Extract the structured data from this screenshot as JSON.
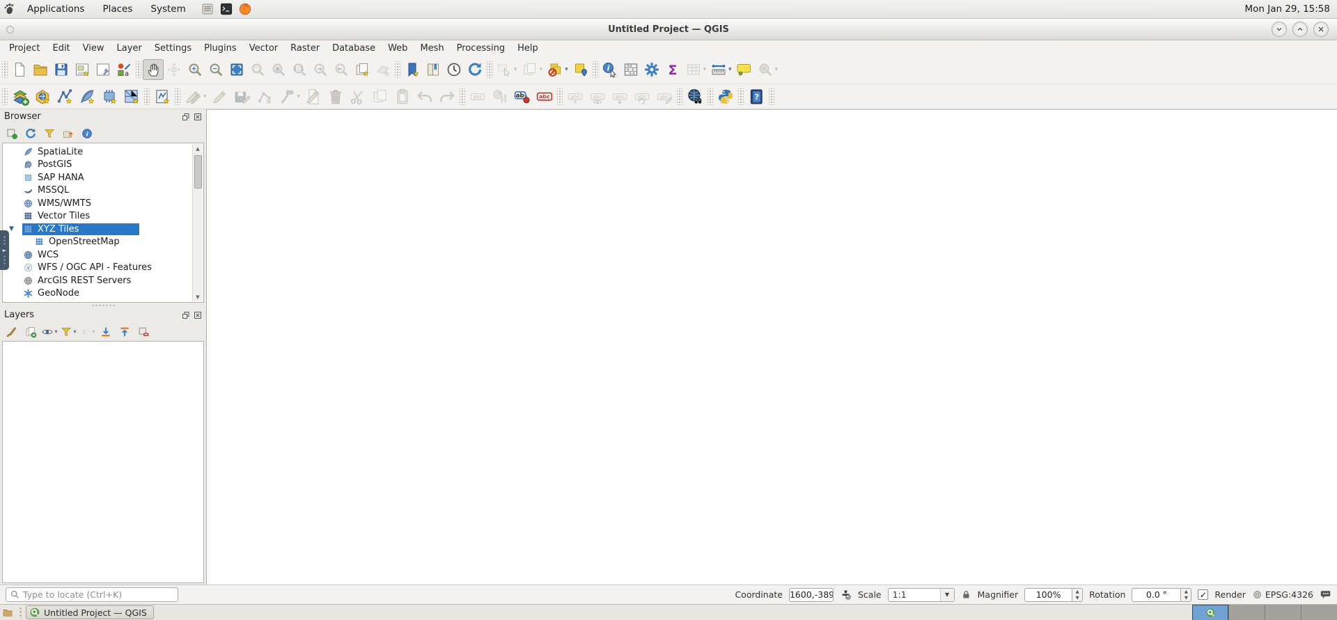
{
  "desktop": {
    "top_panel": {
      "menus": [
        {
          "label": "Applications"
        },
        {
          "label": "Places"
        },
        {
          "label": "System"
        }
      ],
      "launchers": [
        {
          "name": "file-manager",
          "icon": "files"
        },
        {
          "name": "terminal",
          "icon": "terminal"
        },
        {
          "name": "firefox",
          "icon": "firefox"
        }
      ],
      "clock": "Mon Jan 29, 15:58"
    },
    "taskbar": {
      "window_button_label": "Untitled Project — QGIS",
      "workspace_count": 4,
      "active_workspace": 1
    }
  },
  "window": {
    "title": "Untitled Project — QGIS",
    "menubar": [
      "Project",
      "Edit",
      "View",
      "Layer",
      "Settings",
      "Plugins",
      "Vector",
      "Raster",
      "Database",
      "Web",
      "Mesh",
      "Processing",
      "Help"
    ],
    "toolbar_row1": [
      {
        "t": "sep"
      },
      {
        "n": "new-project",
        "i": "page"
      },
      {
        "n": "open-project",
        "i": "folder"
      },
      {
        "n": "save-project",
        "i": "floppy"
      },
      {
        "n": "new-print-layout",
        "i": "layout"
      },
      {
        "n": "show-layout-manager",
        "i": "layout-manager"
      },
      {
        "n": "style-manager",
        "i": "style-manager"
      },
      {
        "t": "sep"
      },
      {
        "n": "pan-map",
        "i": "hand",
        "active": true
      },
      {
        "n": "pan-to-selection",
        "i": "pan-selection",
        "disabled": true
      },
      {
        "n": "zoom-in",
        "i": "zoom-in"
      },
      {
        "n": "zoom-out",
        "i": "zoom-out"
      },
      {
        "n": "zoom-full",
        "i": "zoom-full"
      },
      {
        "n": "zoom-to-selection",
        "i": "zoom-selection",
        "disabled": true
      },
      {
        "n": "zoom-to-layer",
        "i": "zoom-layer",
        "disabled": true
      },
      {
        "n": "zoom-native-resolution",
        "i": "zoom-native",
        "disabled": true
      },
      {
        "n": "zoom-last",
        "i": "zoom-last",
        "disabled": true
      },
      {
        "n": "zoom-next",
        "i": "zoom-next",
        "disabled": true
      },
      {
        "n": "new-map-view",
        "i": "new-map-view"
      },
      {
        "n": "new-3d-map-view",
        "i": "new-3d-map-view",
        "disabled": true
      },
      {
        "t": "sep"
      },
      {
        "n": "new-spatial-bookmark",
        "i": "bookmark-new"
      },
      {
        "n": "show-spatial-bookmarks",
        "i": "bookmark-show"
      },
      {
        "n": "temporal-controller",
        "i": "clock"
      },
      {
        "n": "refresh-map",
        "i": "refresh"
      },
      {
        "t": "sep"
      },
      {
        "n": "select-features",
        "i": "select-rect",
        "disabled": true,
        "dd": true
      },
      {
        "n": "select-features-by-form",
        "i": "select-form",
        "disabled": true,
        "dd": true
      },
      {
        "n": "deselect-all-layers",
        "i": "deselect",
        "dd": true
      },
      {
        "n": "select-by-value",
        "i": "select-value"
      },
      {
        "t": "sep"
      },
      {
        "n": "identify-features",
        "i": "identify"
      },
      {
        "n": "field-calculator",
        "i": "abacus"
      },
      {
        "n": "processing-toolbox",
        "i": "gear"
      },
      {
        "n": "statistical-summary",
        "i": "sigma"
      },
      {
        "n": "open-attribute-table",
        "i": "attr-table",
        "disabled": true,
        "dd": true
      },
      {
        "n": "measure-line",
        "i": "measure",
        "dd": true
      },
      {
        "n": "map-tips",
        "i": "maptips"
      },
      {
        "n": "nominatim-geocoder",
        "i": "geocode",
        "disabled": true,
        "dd": true
      }
    ],
    "toolbar_row2": [
      {
        "t": "sep"
      },
      {
        "n": "data-source-manager",
        "i": "datasource"
      },
      {
        "n": "new-geopackage-layer",
        "i": "new-gpkg"
      },
      {
        "n": "new-shapefile-layer",
        "i": "new-shp"
      },
      {
        "n": "new-spatialite-layer",
        "i": "new-sl"
      },
      {
        "n": "new-virtual-layer",
        "i": "new-virtual"
      },
      {
        "n": "new-mesh-layer",
        "i": "new-mesh"
      },
      {
        "t": "sep"
      },
      {
        "n": "new-temporary-scratch-layer",
        "i": "new-scratch"
      },
      {
        "t": "sep"
      },
      {
        "n": "current-edits",
        "i": "current-edits",
        "disabled": true,
        "dd": true
      },
      {
        "n": "toggle-editing",
        "i": "pencil",
        "disabled": true
      },
      {
        "n": "save-layer-edits",
        "i": "save-edits",
        "disabled": true
      },
      {
        "n": "add-feature",
        "i": "digitize",
        "disabled": true
      },
      {
        "n": "vertex-tool",
        "i": "vertex",
        "disabled": true,
        "dd": true
      },
      {
        "n": "modify-attributes",
        "i": "modify",
        "disabled": true
      },
      {
        "n": "delete-selected",
        "i": "trash",
        "disabled": true
      },
      {
        "n": "cut-features",
        "i": "scissors",
        "disabled": true
      },
      {
        "n": "copy-features",
        "i": "copy",
        "disabled": true
      },
      {
        "n": "paste-features",
        "i": "paste",
        "disabled": true
      },
      {
        "n": "undo",
        "i": "undo",
        "disabled": true
      },
      {
        "n": "redo",
        "i": "redo",
        "disabled": true
      },
      {
        "t": "sep"
      },
      {
        "n": "layer-labeling",
        "i": "label-abc",
        "disabled": true
      },
      {
        "n": "layer-diagram",
        "i": "diagram",
        "disabled": true
      },
      {
        "n": "layer-labeling-options",
        "i": "labeling-options"
      },
      {
        "n": "layer-diagram-options",
        "i": "diagram-options"
      },
      {
        "t": "sep"
      },
      {
        "n": "pin-unpin-labels",
        "i": "label-pin",
        "disabled": true
      },
      {
        "n": "highlight-pinned-labels",
        "i": "label-eye",
        "disabled": true
      },
      {
        "n": "move-label",
        "i": "label-move",
        "disabled": true
      },
      {
        "n": "rotate-label",
        "i": "label-rotate",
        "disabled": true
      },
      {
        "n": "change-label",
        "i": "label-edit",
        "disabled": true
      },
      {
        "t": "sep"
      },
      {
        "n": "metasearch",
        "i": "metasearch"
      },
      {
        "t": "sep"
      },
      {
        "n": "python-console",
        "i": "python"
      },
      {
        "t": "sep"
      },
      {
        "n": "help-contents",
        "i": "help"
      },
      {
        "t": "sep"
      }
    ],
    "browser_panel": {
      "title": "Browser",
      "toolbar": [
        {
          "n": "add-selected-layers",
          "i": "badd"
        },
        {
          "n": "refresh-browser",
          "i": "brefresh"
        },
        {
          "n": "filter-browser",
          "i": "funnel"
        },
        {
          "n": "collapse-all",
          "i": "collapse"
        },
        {
          "n": "enable-properties-widget",
          "i": "info"
        }
      ],
      "tree": [
        {
          "label": "SpatiaLite",
          "icon": "tree-spatialite"
        },
        {
          "label": "PostGIS",
          "icon": "tree-postgis"
        },
        {
          "label": "SAP HANA",
          "icon": "tree-saphana"
        },
        {
          "label": "MSSQL",
          "icon": "tree-mssql"
        },
        {
          "label": "WMS/WMTS",
          "icon": "tree-wms"
        },
        {
          "label": "Vector Tiles",
          "icon": "tree-vectortiles"
        },
        {
          "label": "XYZ Tiles",
          "icon": "tree-xyz",
          "selected": true,
          "expanded": true
        },
        {
          "label": "OpenStreetMap",
          "icon": "tree-osm",
          "child": true
        },
        {
          "label": "WCS",
          "icon": "tree-wcs"
        },
        {
          "label": "WFS / OGC API - Features",
          "icon": "tree-wfs"
        },
        {
          "label": "ArcGIS REST Servers",
          "icon": "tree-arcgis"
        },
        {
          "label": "GeoNode",
          "icon": "tree-geonode"
        }
      ]
    },
    "layers_panel": {
      "title": "Layers",
      "toolbar": [
        {
          "n": "open-layer-styling",
          "i": "brush"
        },
        {
          "n": "add-group",
          "i": "add-group"
        },
        {
          "n": "manage-map-themes",
          "i": "themes",
          "dd": true
        },
        {
          "n": "filter-legend",
          "i": "funnel",
          "dd": true
        },
        {
          "n": "filter-legend-by-expression",
          "i": "filter-expr",
          "disabled": true,
          "dd": true
        },
        {
          "n": "expand-all-layers",
          "i": "expand-all"
        },
        {
          "n": "collapse-all-layers",
          "i": "collapse-all"
        },
        {
          "n": "remove-layer-group",
          "i": "remove-layer"
        }
      ]
    },
    "statusbar": {
      "locator_placeholder": "Type to locate (Ctrl+K)",
      "coordinate_label": "Coordinate",
      "coordinate_value": "1600,-389",
      "scale_label": "Scale",
      "scale_value": "1:1",
      "magnifier_label": "Magnifier",
      "magnifier_value": "100%",
      "rotation_label": "Rotation",
      "rotation_value": "0.0 °",
      "render_label": "Render",
      "render_checked": true,
      "crs": "EPSG:4326"
    }
  }
}
